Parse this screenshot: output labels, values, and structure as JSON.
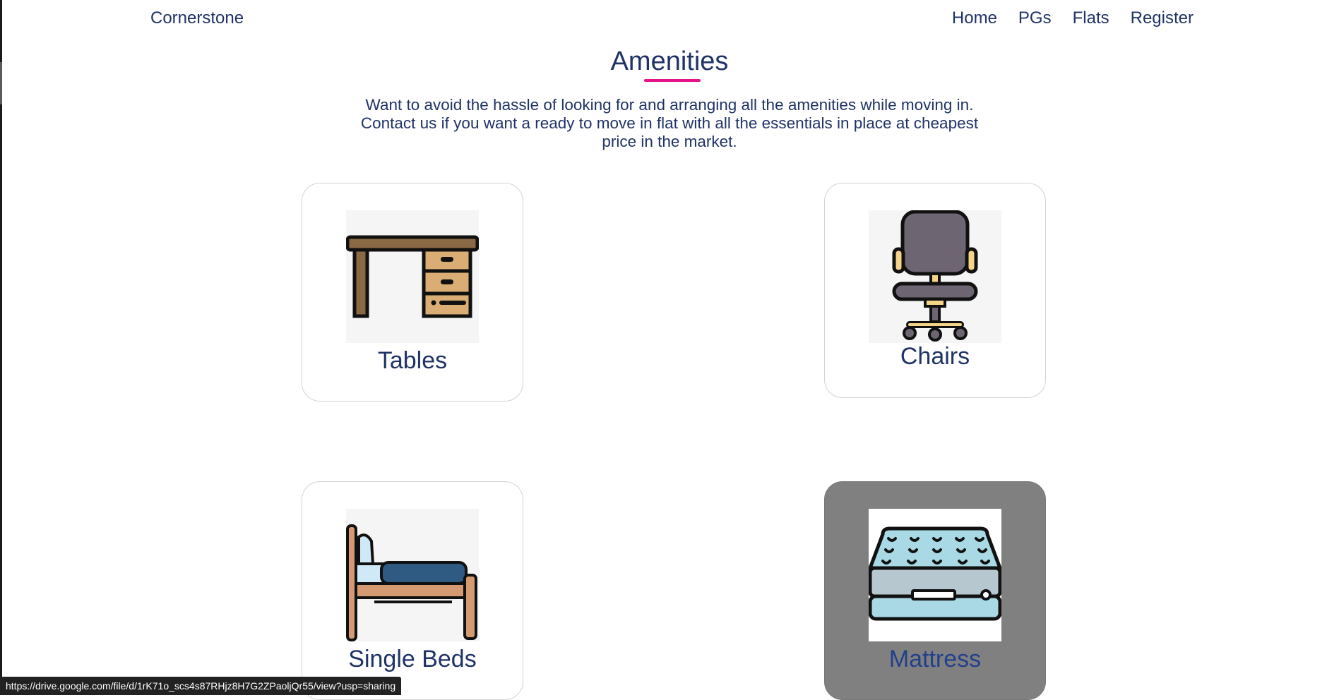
{
  "nav": {
    "brand": "Cornerstone",
    "links": [
      "Home",
      "PGs",
      "Flats",
      "Register"
    ]
  },
  "section": {
    "title": "Amenities",
    "intro": "Want to avoid the hassle of looking for and arranging all the amenities while moving in. Contact us if you want a ready to move in flat with all the essentials in place at cheapest price in the market."
  },
  "cards": [
    {
      "label": "Tables",
      "icon": "desk-icon"
    },
    {
      "label": "Chairs",
      "icon": "office-chair-icon"
    },
    {
      "label": "Single Beds",
      "icon": "single-bed-icon"
    },
    {
      "label": "Mattress",
      "icon": "mattress-icon"
    }
  ],
  "status_bar": {
    "url": "https://drive.google.com/file/d/1rK71o_scs4s87RHjz8H7G2ZPaoljQr55/view?usp=sharing"
  },
  "colors": {
    "text": "#1f3366",
    "accent_underline": "#e5128c",
    "hover_card": "#808080"
  }
}
